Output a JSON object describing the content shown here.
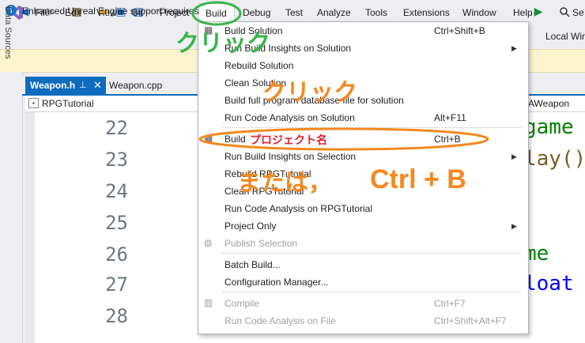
{
  "menu": {
    "items": [
      "File",
      "Edit",
      "View",
      "Git",
      "Project",
      "Build",
      "Debug",
      "Test",
      "Analyze",
      "Tools",
      "Extensions",
      "Window",
      "Help"
    ],
    "search_label": "Se"
  },
  "toolbar": {
    "run_label": "Local Win"
  },
  "infobar": {
    "text": "Enhanced Unreal Engine support requires"
  },
  "sidepanel": {
    "label": "Data Sources"
  },
  "tabs": [
    {
      "label": "Weapon.h",
      "active": true
    },
    {
      "label": "Weapon.cpp",
      "active": false
    }
  ],
  "navbar": {
    "project": "RPGTutorial",
    "class": "AWeapon"
  },
  "editor": {
    "line_numbers": [
      "22",
      "23",
      "24",
      "25",
      "26",
      "27",
      "28"
    ],
    "code_fragments": [
      "game",
      "lay()",
      "me",
      "loat"
    ]
  },
  "build_menu": {
    "items": [
      {
        "label": "Build Solution",
        "shortcut": "Ctrl+Shift+B",
        "submenu": false,
        "disabled": false
      },
      {
        "label": "Run Build Insights on Solution",
        "shortcut": "",
        "submenu": true,
        "disabled": false
      },
      {
        "label": "Rebuild Solution",
        "shortcut": "",
        "submenu": false,
        "disabled": false
      },
      {
        "label": "Clean Solution",
        "shortcut": "",
        "submenu": false,
        "disabled": false
      },
      {
        "label": "Build full program database file for solution",
        "shortcut": "",
        "submenu": false,
        "disabled": false
      },
      {
        "label": "Run Code Analysis on Solution",
        "shortcut": "Alt+F11",
        "submenu": false,
        "disabled": false
      },
      {
        "label": "Build",
        "shortcut": "Ctrl+B",
        "submenu": false,
        "disabled": false
      },
      {
        "label": "Run Build Insights on Selection",
        "shortcut": "",
        "submenu": true,
        "disabled": false
      },
      {
        "label": "Rebuild RPGTutorial",
        "shortcut": "",
        "submenu": false,
        "disabled": false
      },
      {
        "label": "Clean RPGTutorial",
        "shortcut": "",
        "submenu": false,
        "disabled": false
      },
      {
        "label": "Run Code Analysis on RPGTutorial",
        "shortcut": "",
        "submenu": false,
        "disabled": false
      },
      {
        "label": "Project Only",
        "shortcut": "",
        "submenu": true,
        "disabled": false
      },
      {
        "label": "Publish Selection",
        "shortcut": "",
        "submenu": false,
        "disabled": true
      },
      {
        "label": "Batch Build...",
        "shortcut": "",
        "submenu": false,
        "disabled": false
      },
      {
        "label": "Configuration Manager...",
        "shortcut": "",
        "submenu": false,
        "disabled": false
      },
      {
        "label": "Compile",
        "shortcut": "Ctrl+F7",
        "submenu": false,
        "disabled": true
      },
      {
        "label": "Run Code Analysis on File",
        "shortcut": "Ctrl+Shift+Alt+F7",
        "submenu": false,
        "disabled": true
      }
    ]
  },
  "annotations": {
    "click_1": "クリック",
    "click_2": "クリック",
    "project_name": "プロジェクト名",
    "or_ctrl_b": "または，",
    "ctrl_b": "Ctrl + B"
  },
  "colors": {
    "accent": "#0f6cbd",
    "annotation_green": "#39b54a",
    "annotation_orange": "#f5881f",
    "annotation_red": "#e0202a"
  }
}
